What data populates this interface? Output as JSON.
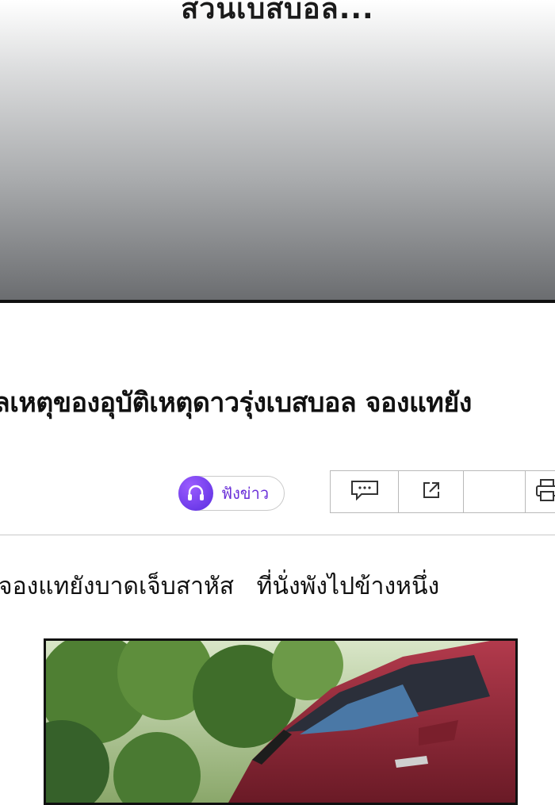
{
  "top_panel": {
    "caption": "สวนเบสบอล..."
  },
  "article": {
    "headline": "มูลเหตุของอุบัติเหตุดาวรุ่งเบสบอล จองแทยัง",
    "subline": "จองแทยังบาดเจ็บสาหัส   ที่นั่งพังไปข้างหนึ่ง"
  },
  "listen": {
    "label": "ฟังข่าว",
    "icon": "headphones-icon"
  },
  "toolbar": {
    "icons": [
      "comment-icon",
      "share-icon",
      "empty",
      "print-icon"
    ]
  },
  "colors": {
    "accent": "#6a2fd8",
    "border": "#b9b9b9"
  }
}
